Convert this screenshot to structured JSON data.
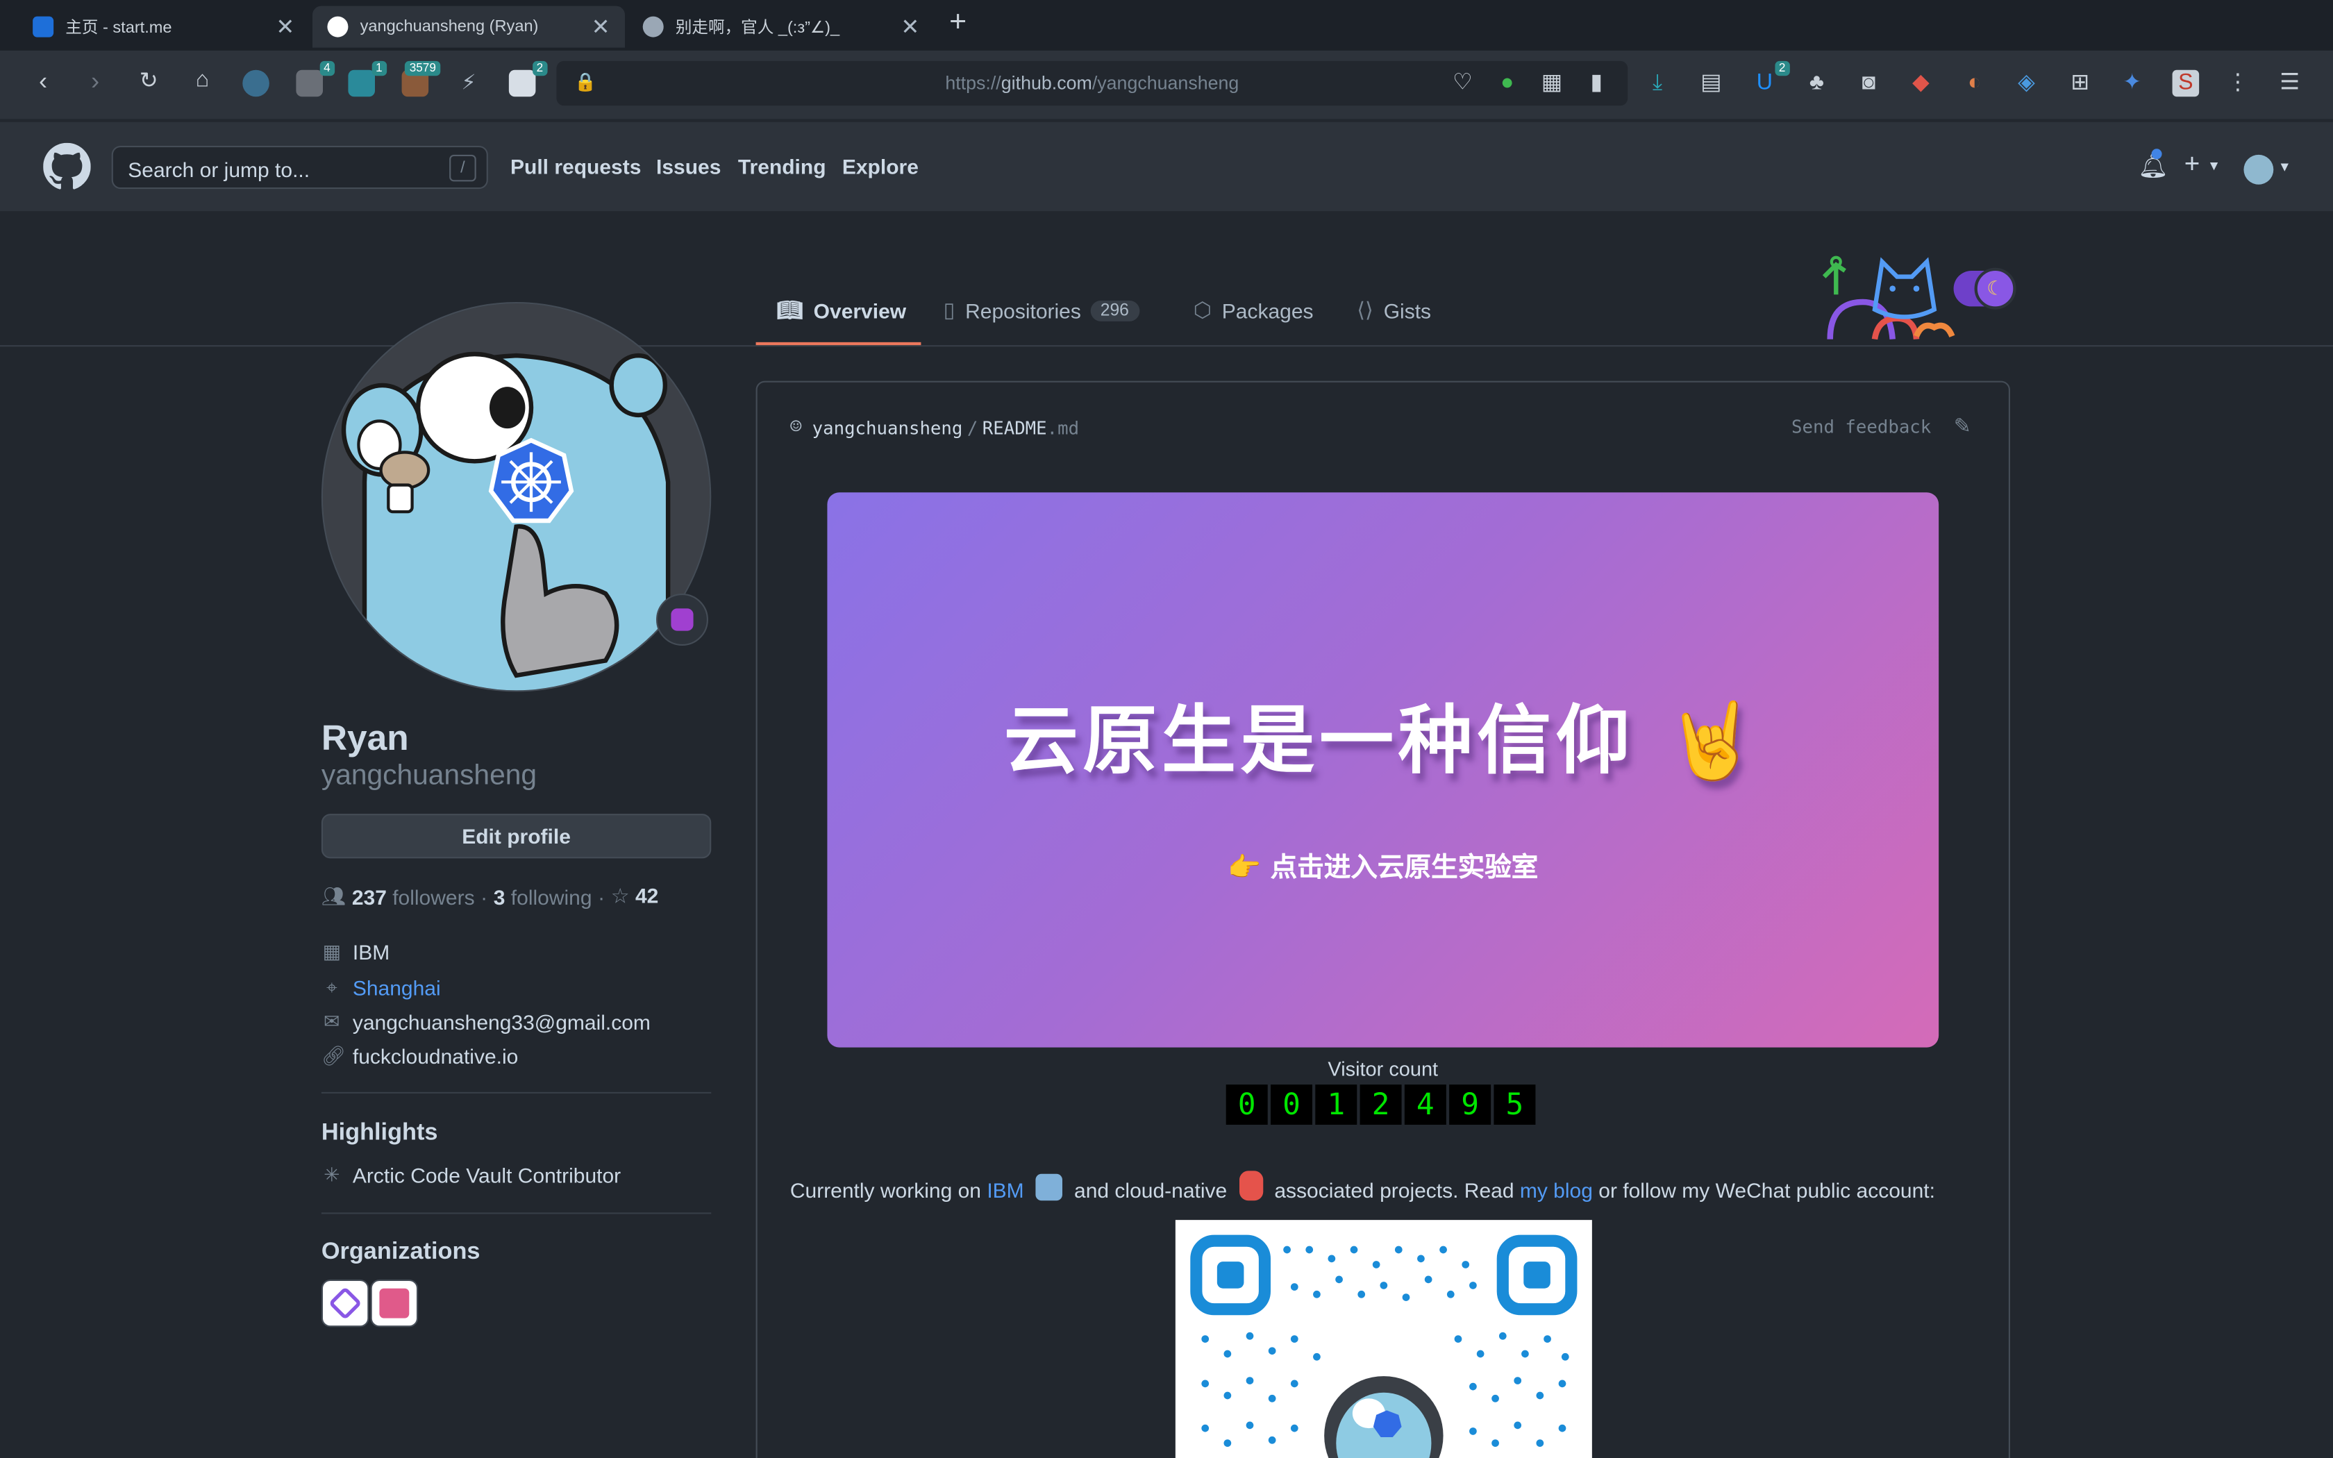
{
  "browser": {
    "tabs": [
      {
        "title": "主页 - start.me"
      },
      {
        "title": "yangchuansheng (Ryan)"
      },
      {
        "title": "别走啊，官人 _(:з”∠)_"
      }
    ],
    "url_prefix": "https://",
    "url_domain": "github.com",
    "url_path": "/yangchuansheng",
    "extension_badges": [
      "4",
      "1",
      "3579",
      "2",
      "2"
    ]
  },
  "gh_header": {
    "search_placeholder": "Search or jump to...",
    "search_key": "/",
    "nav": [
      "Pull requests",
      "Issues",
      "Trending",
      "Explore"
    ]
  },
  "profile_tabs": {
    "overview": "Overview",
    "repositories": "Repositories",
    "repo_count": "296",
    "packages": "Packages",
    "gists": "Gists"
  },
  "profile": {
    "name": "Ryan",
    "login": "yangchuansheng",
    "edit_label": "Edit profile",
    "followers_count": "237",
    "followers_label": "followers",
    "following_count": "3",
    "following_label": "following",
    "stars": "42",
    "company": "IBM",
    "location": "Shanghai",
    "email": "yangchuansheng33@gmail.com",
    "website": "fuckcloudnative.io"
  },
  "highlights": {
    "title": "Highlights",
    "item": "Arctic Code Vault Contributor"
  },
  "organizations": {
    "title": "Organizations"
  },
  "readme": {
    "owner": "yangchuansheng",
    "sep": "/",
    "file": "README",
    "ext": ".md",
    "feedback": "Send feedback",
    "banner_title": "云原生是一种信仰 🤘",
    "banner_sub": "👉 点击进入云原生实验室",
    "visitor_label": "Visitor count",
    "visitor_digits": [
      "0",
      "0",
      "1",
      "2",
      "4",
      "9",
      "5"
    ],
    "intro_1": "Currently working on ",
    "intro_ibm": "IBM",
    "intro_2": " and cloud-native ",
    "intro_3": " associated projects. Read ",
    "intro_blog": "my blog",
    "intro_4": " or follow my WeChat public account:"
  },
  "colors": {
    "accent_link": "#539bf5",
    "tab_underline": "#ec775c",
    "background": "#22272e"
  }
}
